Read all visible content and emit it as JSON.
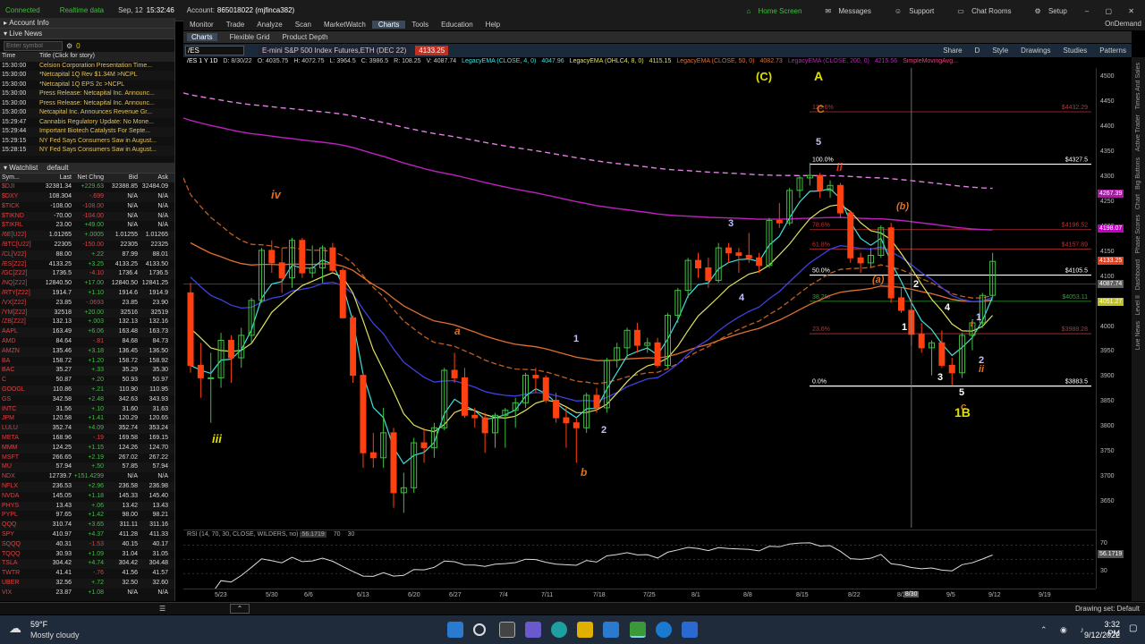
{
  "status": {
    "connected": "Connected",
    "realtime": "Realtime data",
    "date": "Sep, 12",
    "time": "15:32:46",
    "account_label": "Account:",
    "account": "865018022 (mjfinca382)"
  },
  "topnav": {
    "home": "Home Screen",
    "messages": "Messages",
    "support": "Support",
    "chat": "Chat Rooms",
    "setup": "Setup"
  },
  "maintabs": [
    "Monitor",
    "Trade",
    "Analyze",
    "Scan",
    "MarketWatch",
    "Charts",
    "Tools",
    "Education",
    "Help"
  ],
  "ondemand": "OnDemand",
  "subtabs": [
    "Charts",
    "Flexible Grid",
    "Product Depth"
  ],
  "symbol": {
    "ticker": "/ES",
    "desc": "E-mini S&P 500 Index Futures,ETH (DEC 22)",
    "last": "4133.25",
    "share": "Share",
    "period": "D",
    "style": "Style",
    "drawings": "Drawings",
    "studies": "Studies",
    "patterns": "Patterns"
  },
  "studybar": [
    "/ES 1 Y 1D",
    "D: 8/30/22",
    "O: 4035.75",
    "H: 4072.75",
    "L: 3964.5",
    "C: 3986.5",
    "R: 108.25",
    "V: 4087.74",
    "LegacyEMA (CLOSE, 4, 0)",
    "4047.96",
    "LegacyEMA (OHLC4, 8, 0)",
    "4115.15",
    "LegacyEMA (CLOSE, 50, 0)",
    "4082.73",
    "LegacyEMA (CLOSE, 200, 0)",
    "4215.56",
    "SimpleMovingAvg..."
  ],
  "account_info": "Account Info",
  "live_news": "Live News",
  "news_search_placeholder": "Enter symbol",
  "news_count": "0",
  "news_headers": {
    "time": "Time",
    "title": "Title (Click for story)"
  },
  "news": [
    {
      "t": "15:30:00",
      "h": "Celsion Corporation Presentation Time..."
    },
    {
      "t": "15:30:00",
      "h": "*Netcapital 1Q Rev $1.34M >NCPL"
    },
    {
      "t": "15:30:00",
      "h": "*Netcapital 1Q EPS 2c >NCPL"
    },
    {
      "t": "15:30:00",
      "h": "Press Release: Netcapital Inc. Announc..."
    },
    {
      "t": "15:30:00",
      "h": "Press Release: Netcapital Inc. Announc..."
    },
    {
      "t": "15:30:00",
      "h": "Netcapital Inc. Announces Revenue Gr..."
    },
    {
      "t": "15:29:47",
      "h": "Cannabis Regulatory Update: No Mone..."
    },
    {
      "t": "15:29:44",
      "h": "Important Biotech Catalysts For Septe..."
    },
    {
      "t": "15:29:15",
      "h": "NY Fed Says Consumers Saw in August..."
    },
    {
      "t": "15:28:15",
      "h": "NY Fed Says Consumers Saw in August..."
    }
  ],
  "watchlist": {
    "title": "Watchlist",
    "name": "default",
    "headers": [
      "Sym...",
      "Last",
      "Net Chng",
      "Bid",
      "Ask"
    ],
    "rows": [
      [
        "$DJI",
        "32381.34",
        "+229.63",
        "32388.85",
        "32484.09",
        "u"
      ],
      [
        "$DXY",
        "108.304",
        "-.699",
        "N/A",
        "N/A",
        "d"
      ],
      [
        "$TICK",
        "-108.00",
        "-108.00",
        "N/A",
        "N/A",
        "d"
      ],
      [
        "$TIKND",
        "-70.00",
        "-104.00",
        "N/A",
        "N/A",
        "d"
      ],
      [
        "$TIKRL",
        "23.00",
        "+49.00",
        "N/A",
        "N/A",
        "u"
      ],
      [
        "/6E[U22]",
        "1.01265",
        "+.0005",
        "1.01255",
        "1.01265",
        "u"
      ],
      [
        "/BTC[U22]",
        "22305",
        "-150.00",
        "22305",
        "22325",
        "d"
      ],
      [
        "/CL[V22]",
        "88.00",
        "+.22",
        "87.99",
        "88.01",
        "u"
      ],
      [
        "/ES[Z22]",
        "4133.25",
        "+3.25",
        "4133.25",
        "4133.50",
        "u"
      ],
      [
        "/GC[Z22]",
        "1736.5",
        "-4.10",
        "1736.4",
        "1736.5",
        "d"
      ],
      [
        "/NQ[Z22]",
        "12840.50",
        "+17.00",
        "12840.50",
        "12841.25",
        "u"
      ],
      [
        "/RTY[Z22]",
        "1914.7",
        "+1.10",
        "1914.6",
        "1914.9",
        "u"
      ],
      [
        "/VX[Z22]",
        "23.85",
        "-.0693",
        "23.85",
        "23.90",
        "d"
      ],
      [
        "/YM[Z22]",
        "32518",
        "+20.00",
        "32516",
        "32519",
        "u"
      ],
      [
        "/ZB[Z22]",
        "132.13",
        "+.003",
        "132.13",
        "132.16",
        "u"
      ],
      [
        "AAPL",
        "163.49",
        "+6.06",
        "163.48",
        "163.73",
        "u"
      ],
      [
        "AMD",
        "84.64",
        "-.81",
        "84.68",
        "84.73",
        "d"
      ],
      [
        "AMZN",
        "135.46",
        "+3.18",
        "136.45",
        "136.50",
        "u"
      ],
      [
        "BA",
        "158.72",
        "+1.20",
        "158.72",
        "158.92",
        "u"
      ],
      [
        "BAC",
        "35.27",
        "+.33",
        "35.29",
        "35.30",
        "u"
      ],
      [
        "C",
        "50.87",
        "+.20",
        "50.93",
        "50.97",
        "u"
      ],
      [
        "GOOGL",
        "110.86",
        "+.21",
        "110.90",
        "110.95",
        "u"
      ],
      [
        "GS",
        "342.58",
        "+2.48",
        "342.63",
        "343.93",
        "u"
      ],
      [
        "INTC",
        "31.56",
        "+.10",
        "31.60",
        "31.63",
        "u"
      ],
      [
        "JPM",
        "120.58",
        "+1.41",
        "120.29",
        "120.65",
        "u"
      ],
      [
        "LULU",
        "352.74",
        "+4.09",
        "352.74",
        "353.24",
        "u"
      ],
      [
        "META",
        "168.96",
        "-.19",
        "169.58",
        "169.15",
        "d"
      ],
      [
        "MMM",
        "124.25",
        "+1.15",
        "124.26",
        "124.70",
        "u"
      ],
      [
        "MSFT",
        "266.65",
        "+2.19",
        "267.02",
        "267.22",
        "u"
      ],
      [
        "MU",
        "57.94",
        "+.50",
        "57.85",
        "57.94",
        "u"
      ],
      [
        "NDX",
        "12739.7",
        "+151.4299",
        "N/A",
        "N/A",
        "u"
      ],
      [
        "NFLX",
        "236.53",
        "+2.96",
        "236.58",
        "236.98",
        "u"
      ],
      [
        "NVDA",
        "145.05",
        "+1.18",
        "145.33",
        "145.40",
        "u"
      ],
      [
        "PHYS",
        "13.43",
        "+.06",
        "13.42",
        "13.43",
        "u"
      ],
      [
        "PYPL",
        "97.65",
        "+1.42",
        "98.00",
        "98.21",
        "u"
      ],
      [
        "QQQ",
        "310.74",
        "+3.65",
        "311.11",
        "311.16",
        "u"
      ],
      [
        "SPY",
        "410.97",
        "+4.37",
        "411.28",
        "411.33",
        "u"
      ],
      [
        "SQQQ",
        "40.31",
        "-1.53",
        "40.15",
        "40.17",
        "d"
      ],
      [
        "TQQQ",
        "30.93",
        "+1.09",
        "31.04",
        "31.05",
        "u"
      ],
      [
        "TSLA",
        "304.42",
        "+4.74",
        "304.42",
        "304.48",
        "u"
      ],
      [
        "TWTR",
        "41.41",
        "-.76",
        "41.56",
        "41.57",
        "d"
      ],
      [
        "UBER",
        "32.56",
        "+.72",
        "32.50",
        "32.60",
        "u"
      ],
      [
        "VIX",
        "23.87",
        "+1.08",
        "N/A",
        "N/A",
        "u"
      ]
    ]
  },
  "yaxis_ticks": [
    "4500",
    "4450",
    "4400",
    "4350",
    "4300",
    "4250",
    "4200",
    "4150",
    "4100",
    "4050",
    "4000",
    "3950",
    "3900",
    "3850",
    "3800",
    "3750",
    "3700",
    "3650"
  ],
  "xaxis_ticks": [
    "5/23",
    "5/30",
    "6/6",
    "6/13",
    "6/20",
    "6/27",
    "7/4",
    "7/11",
    "7/18",
    "7/25",
    "8/1",
    "8/8",
    "8/15",
    "8/22",
    "8/29",
    "9/5",
    "9/12",
    "9/19"
  ],
  "crosshair_date": "8/30",
  "price_tags": [
    {
      "v": "4267.39",
      "c": "#a020a0"
    },
    {
      "v": "4198.07",
      "c": "#c000c0"
    },
    {
      "v": "4133.25",
      "c": "#e04020"
    },
    {
      "v": "4087.74",
      "c": "#606060"
    },
    {
      "v": "4051.27",
      "c": "#c0c020"
    }
  ],
  "fib": [
    {
      "p": "123.6%",
      "val": "$4432.29",
      "price": 4432.29,
      "color": "#c03030"
    },
    {
      "p": "100.0%",
      "val": "$4327.5",
      "price": 4327.5,
      "color": "#ffffff"
    },
    {
      "p": "78.6%",
      "val": "$4196.52",
      "price": 4196.52,
      "color": "#c03030"
    },
    {
      "p": "61.8%",
      "val": "$4157.89",
      "price": 4157.89,
      "color": "#c03030"
    },
    {
      "p": "50.0%",
      "val": "$4105.5",
      "price": 4105.5,
      "color": "#ffffff"
    },
    {
      "p": "38.2%",
      "val": "$4053.11",
      "price": 4053.11,
      "color": "#30a030"
    },
    {
      "p": "23.6%",
      "val": "$3988.28",
      "price": 3988.28,
      "color": "#c03030"
    },
    {
      "p": "0.0%",
      "val": "$3883.5",
      "price": 3883.5,
      "color": "#ffffff"
    }
  ],
  "wave_labels": [
    {
      "text": "(C)",
      "color": "#e0e000"
    },
    {
      "text": "A",
      "color": "#e0e000"
    },
    {
      "text": "C",
      "color": "#e07020"
    },
    {
      "text": "5",
      "color": "#c0c0ff"
    },
    {
      "text": "ii",
      "color": "#e03020"
    },
    {
      "text": "iv",
      "color": "#e07020"
    },
    {
      "text": "iii",
      "color": "#e0e000"
    },
    {
      "text": "a",
      "color": "#e07020"
    },
    {
      "text": "b",
      "color": "#e07020"
    },
    {
      "text": "1",
      "color": "#c0c0ff"
    },
    {
      "text": "2",
      "color": "#c0c0ff"
    },
    {
      "text": "3",
      "color": "#c0c0ff"
    },
    {
      "text": "4",
      "color": "#c0c0ff"
    },
    {
      "text": "(b)",
      "color": "#e07020"
    },
    {
      "text": "(a)",
      "color": "#e07020"
    },
    {
      "text": "1",
      "color": "#ffffff"
    },
    {
      "text": "2",
      "color": "#ffffff"
    },
    {
      "text": "3",
      "color": "#ffffff"
    },
    {
      "text": "4",
      "color": "#ffffff"
    },
    {
      "text": "5",
      "color": "#ffffff"
    },
    {
      "text": "c",
      "color": "#e07020"
    },
    {
      "text": "1B",
      "color": "#e0e000"
    },
    {
      "text": "1",
      "color": "#c0c0ff"
    },
    {
      "text": "i",
      "color": "#e07020"
    },
    {
      "text": "2",
      "color": "#c0c0ff"
    },
    {
      "text": "ii",
      "color": "#e07020"
    }
  ],
  "rsi": {
    "label": "RSI (14, 70, 30, CLOSE, WILDERS, no)",
    "value": "56.1719",
    "ob": "70",
    "os": "30",
    "axis": [
      "70",
      "50",
      "30"
    ]
  },
  "drawing_set": "Drawing set: Default",
  "right_tabs": [
    "Times And Sales",
    "Active Trader",
    "Big Buttons",
    "Chart",
    "Phase Scores",
    "Dashboard",
    "Level II",
    "Live News"
  ],
  "weather": {
    "temp": "59°F",
    "desc": "Mostly cloudy"
  },
  "clock": {
    "time": "3:32 PM",
    "date": "9/12/2022"
  },
  "chart_data": {
    "type": "candlestick",
    "ylim": [
      3600,
      4520
    ],
    "x": [
      "5/18",
      "5/19",
      "5/20",
      "5/23",
      "5/24",
      "5/25",
      "5/26",
      "5/27",
      "5/31",
      "6/1",
      "6/2",
      "6/3",
      "6/6",
      "6/7",
      "6/8",
      "6/9",
      "6/10",
      "6/13",
      "6/14",
      "6/15",
      "6/16",
      "6/17",
      "6/21",
      "6/22",
      "6/23",
      "6/24",
      "6/27",
      "6/28",
      "6/29",
      "6/30",
      "7/1",
      "7/5",
      "7/6",
      "7/7",
      "7/8",
      "7/11",
      "7/12",
      "7/13",
      "7/14",
      "7/15",
      "7/18",
      "7/19",
      "7/20",
      "7/21",
      "7/22",
      "7/25",
      "7/26",
      "7/27",
      "7/28",
      "7/29",
      "8/1",
      "8/2",
      "8/3",
      "8/4",
      "8/5",
      "8/8",
      "8/9",
      "8/10",
      "8/11",
      "8/12",
      "8/15",
      "8/16",
      "8/17",
      "8/18",
      "8/19",
      "8/22",
      "8/23",
      "8/24",
      "8/25",
      "8/26",
      "8/29",
      "8/30",
      "8/31",
      "9/1",
      "9/2",
      "9/6",
      "9/7",
      "9/8",
      "9/9",
      "9/12"
    ],
    "ohlc": [
      [
        4070,
        4090,
        3910,
        3925
      ],
      [
        3925,
        3970,
        3860,
        3900
      ],
      [
        3900,
        3950,
        3810,
        3900
      ],
      [
        3900,
        3990,
        3880,
        3975
      ],
      [
        3975,
        3985,
        3890,
        3940
      ],
      [
        3940,
        4000,
        3920,
        3985
      ],
      [
        3985,
        4060,
        3970,
        4055
      ],
      [
        4055,
        4160,
        4050,
        4155
      ],
      [
        4155,
        4175,
        4110,
        4130
      ],
      [
        4130,
        4160,
        4070,
        4100
      ],
      [
        4100,
        4180,
        4080,
        4175
      ],
      [
        4175,
        4180,
        4100,
        4110
      ],
      [
        4110,
        4165,
        4100,
        4120
      ],
      [
        4120,
        4165,
        4090,
        4160
      ],
      [
        4160,
        4170,
        4110,
        4115
      ],
      [
        4115,
        4120,
        4020,
        4020
      ],
      [
        4020,
        4025,
        3890,
        3905
      ],
      [
        3905,
        3910,
        3720,
        3750
      ],
      [
        3750,
        3790,
        3720,
        3740
      ],
      [
        3740,
        3840,
        3720,
        3790
      ],
      [
        3790,
        3800,
        3640,
        3670
      ],
      [
        3670,
        3710,
        3630,
        3680
      ],
      [
        3680,
        3780,
        3670,
        3770
      ],
      [
        3770,
        3800,
        3730,
        3760
      ],
      [
        3760,
        3810,
        3740,
        3800
      ],
      [
        3800,
        3920,
        3795,
        3915
      ],
      [
        3915,
        3950,
        3890,
        3900
      ],
      [
        3900,
        3920,
        3820,
        3825
      ],
      [
        3825,
        3840,
        3800,
        3820
      ],
      [
        3820,
        3830,
        3750,
        3790
      ],
      [
        3790,
        3830,
        3760,
        3825
      ],
      [
        3825,
        3840,
        3760,
        3835
      ],
      [
        3835,
        3860,
        3800,
        3850
      ],
      [
        3850,
        3910,
        3840,
        3905
      ],
      [
        3905,
        3920,
        3870,
        3900
      ],
      [
        3900,
        3905,
        3850,
        3855
      ],
      [
        3855,
        3870,
        3810,
        3820
      ],
      [
        3820,
        3840,
        3760,
        3810
      ],
      [
        3810,
        3820,
        3730,
        3800
      ],
      [
        3800,
        3870,
        3790,
        3865
      ],
      [
        3865,
        3880,
        3830,
        3840
      ],
      [
        3840,
        3940,
        3830,
        3935
      ],
      [
        3935,
        3970,
        3920,
        3960
      ],
      [
        3960,
        4000,
        3940,
        3995
      ],
      [
        3995,
        4010,
        3950,
        3965
      ],
      [
        3965,
        3980,
        3950,
        3970
      ],
      [
        3970,
        3980,
        3920,
        3925
      ],
      [
        3925,
        4030,
        3920,
        4025
      ],
      [
        4025,
        4080,
        4010,
        4075
      ],
      [
        4075,
        4140,
        4060,
        4135
      ],
      [
        4135,
        4150,
        4100,
        4120
      ],
      [
        4120,
        4140,
        4080,
        4095
      ],
      [
        4095,
        4170,
        4090,
        4160
      ],
      [
        4160,
        4170,
        4130,
        4150
      ],
      [
        4150,
        4160,
        4110,
        4145
      ],
      [
        4145,
        4190,
        4130,
        4140
      ],
      [
        4140,
        4150,
        4110,
        4125
      ],
      [
        4125,
        4220,
        4120,
        4215
      ],
      [
        4215,
        4250,
        4200,
        4210
      ],
      [
        4210,
        4280,
        4205,
        4275
      ],
      [
        4275,
        4305,
        4260,
        4300
      ],
      [
        4300,
        4330,
        4285,
        4305
      ],
      [
        4305,
        4310,
        4260,
        4275
      ],
      [
        4275,
        4295,
        4260,
        4285
      ],
      [
        4285,
        4290,
        4220,
        4230
      ],
      [
        4230,
        4235,
        4130,
        4140
      ],
      [
        4140,
        4150,
        4110,
        4130
      ],
      [
        4130,
        4160,
        4120,
        4145
      ],
      [
        4145,
        4205,
        4140,
        4200
      ],
      [
        4200,
        4210,
        4050,
        4060
      ],
      [
        4060,
        4080,
        4030,
        4035
      ],
      [
        4035,
        4073,
        3964,
        3987
      ],
      [
        3987,
        4010,
        3950,
        3960
      ],
      [
        3960,
        3975,
        3905,
        3970
      ],
      [
        3970,
        3995,
        3920,
        3925
      ],
      [
        3925,
        3940,
        3885,
        3910
      ],
      [
        3910,
        3990,
        3900,
        3985
      ],
      [
        3985,
        4015,
        3955,
        4010
      ],
      [
        4010,
        4070,
        4000,
        4065
      ],
      [
        4065,
        4150,
        4060,
        4133
      ]
    ],
    "overlays": [
      {
        "name": "LegacyEMA (CLOSE, 4, 0)",
        "color": "#40e0e0",
        "values": []
      },
      {
        "name": "LegacyEMA (OHLC4, 8, 0)",
        "color": "#e0e060",
        "values": []
      },
      {
        "name": "LegacyEMA (CLOSE, 50, 0)",
        "color": "#e07030",
        "values": []
      },
      {
        "name": "LegacyEMA (CLOSE, 200, 0)",
        "color": "#c020c0",
        "values": []
      }
    ]
  }
}
